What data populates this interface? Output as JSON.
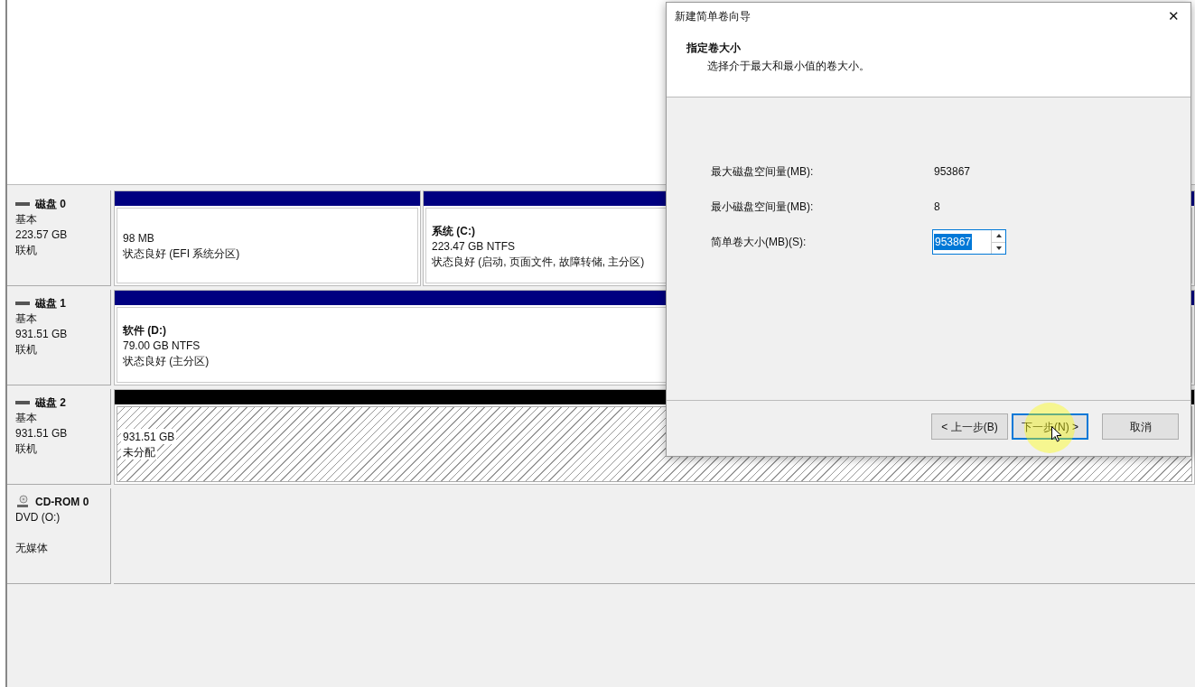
{
  "disks": [
    {
      "kind": "disk",
      "name": "磁盘 0",
      "lines": [
        "基本",
        "223.57 GB",
        "联机"
      ],
      "partitions": [
        {
          "kind": "primary",
          "size": "98 MB",
          "status": "状态良好 (EFI 系统分区)"
        },
        {
          "kind": "primary",
          "title": "系统 (C:)",
          "size": "223.47 GB NTFS",
          "status": "状态良好 (启动, 页面文件, 故障转储, 主分区)"
        }
      ]
    },
    {
      "kind": "disk",
      "name": "磁盘 1",
      "lines": [
        "基本",
        "931.51 GB",
        "联机"
      ],
      "partitions": [
        {
          "kind": "primary",
          "title": "软件 (D:)",
          "size": "79.00 GB NTFS",
          "status": "状态良好 (主分区)"
        }
      ]
    },
    {
      "kind": "disk",
      "name": "磁盘 2",
      "lines": [
        "基本",
        "931.51 GB",
        "联机"
      ],
      "partitions": [
        {
          "kind": "unallocated",
          "size": "931.51 GB",
          "status": "未分配"
        }
      ]
    },
    {
      "kind": "cdrom",
      "name": "CD-ROM 0",
      "lines": [
        "DVD (O:)",
        "无媒体"
      ]
    }
  ],
  "dialog": {
    "title": "新建简单卷向导",
    "close": "✕",
    "heading": "指定卷大小",
    "subheading": "选择介于最大和最小值的卷大小。",
    "fields": [
      {
        "kind": "text",
        "label": "最大磁盘空间量(MB):",
        "value": "953867"
      },
      {
        "kind": "text",
        "label": "最小磁盘空间量(MB):",
        "value": "8"
      },
      {
        "kind": "spin",
        "label": "简单卷大小(MB)(S):",
        "value": "953867",
        "value_selected": true
      }
    ],
    "buttons": [
      {
        "label": "< 上一步(B)",
        "default": false
      },
      {
        "label": "下一步(N) >",
        "default": true
      },
      {
        "label": "取消",
        "default": false
      }
    ]
  }
}
